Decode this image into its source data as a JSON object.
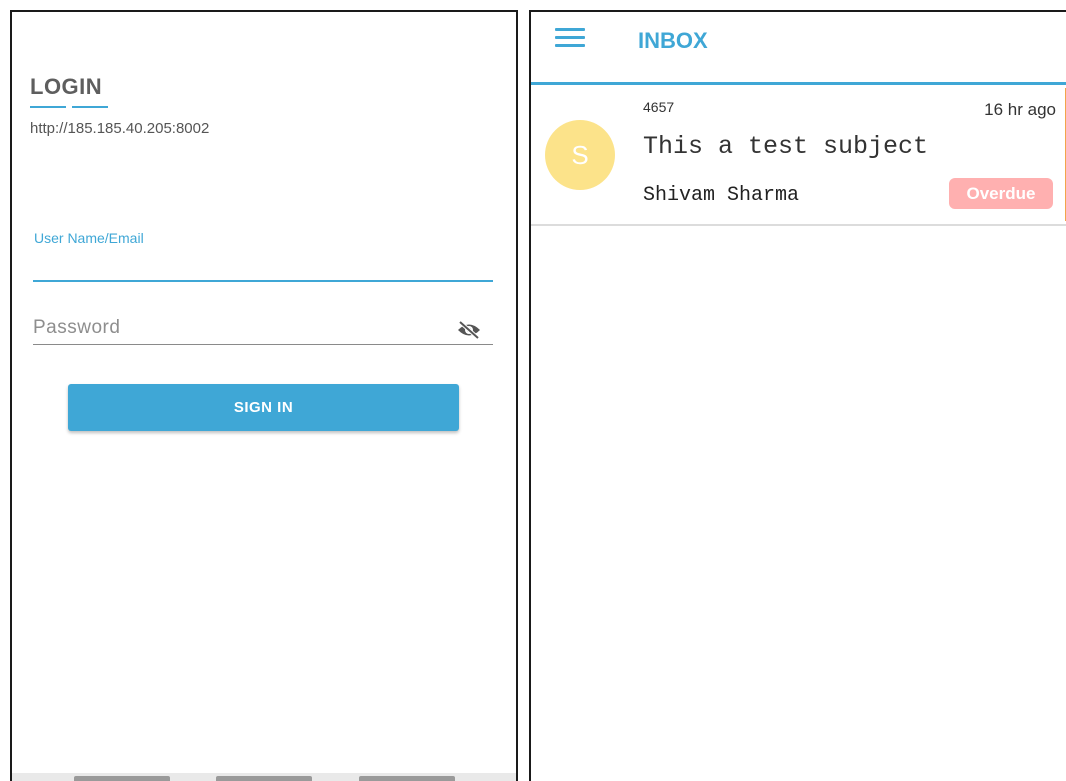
{
  "login": {
    "title": "LOGIN",
    "server_url": "http://185.185.40.205:8002",
    "username_label": "User Name/Email",
    "username_value": "",
    "password_placeholder": "Password",
    "sign_in_label": "SIGN IN",
    "password_toggle_icon": "eye-off-icon"
  },
  "inbox": {
    "title": "INBOX",
    "menu_icon": "hamburger-menu-icon",
    "messages": [
      {
        "id": "4657",
        "time": "16 hr ago",
        "subject": "This a test subject",
        "sender": "Shivam Sharma",
        "avatar_letter": "S",
        "status": "Overdue"
      }
    ]
  },
  "colors": {
    "accent": "#3fa7d6",
    "avatar_bg": "#fce38a",
    "overdue_badge": "#ffb0b0",
    "card_accent": "#f2a54a"
  }
}
